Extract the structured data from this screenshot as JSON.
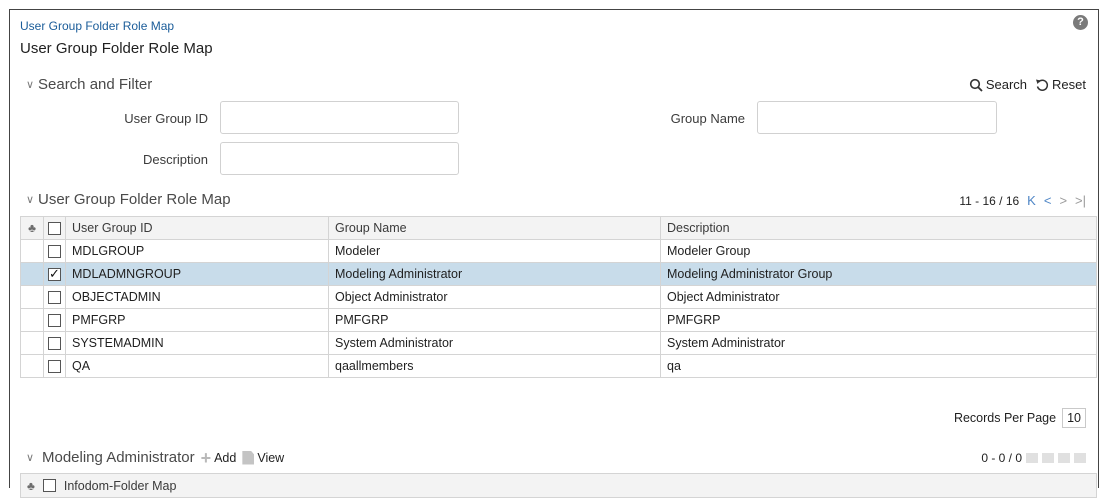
{
  "breadcrumb": "User Group Folder Role Map",
  "page_title": "User Group Folder Role Map",
  "help_icon": "?",
  "search_filter": {
    "title": "Search and Filter",
    "search_label": "Search",
    "reset_label": "Reset",
    "fields": {
      "user_group_id_label": "User Group ID",
      "user_group_id_value": "",
      "group_name_label": "Group Name",
      "group_name_value": "",
      "description_label": "Description",
      "description_value": ""
    }
  },
  "grid": {
    "title": "User Group Folder Role Map",
    "pagination": "11 - 16 / 16",
    "columns": [
      "User Group ID",
      "Group Name",
      "Description"
    ],
    "rows": [
      {
        "id": "MDLGROUP",
        "name": "Modeler",
        "description": "Modeler Group",
        "checked": false
      },
      {
        "id": "MDLADMNGROUP",
        "name": "Modeling Administrator",
        "description": "Modeling Administrator Group",
        "checked": true
      },
      {
        "id": "OBJECTADMIN",
        "name": "Object Administrator",
        "description": "Object Administrator",
        "checked": false
      },
      {
        "id": "PMFGRP",
        "name": "PMFGRP",
        "description": "PMFGRP",
        "checked": false
      },
      {
        "id": "SYSTEMADMIN",
        "name": "System Administrator",
        "description": "System Administrator",
        "checked": false
      },
      {
        "id": "QA",
        "name": "qaallmembers",
        "description": "qa",
        "checked": false
      }
    ],
    "records_per_page_label": "Records Per Page",
    "records_per_page": "10"
  },
  "detail": {
    "title": "Modeling Administrator",
    "add_label": "Add",
    "view_label": "View",
    "pagination": "0 - 0 / 0",
    "column": "Infodom-Folder Map"
  },
  "colors": {
    "selected_row": "#c8dcea",
    "link": "#1a5c99",
    "header_bg": "#f3f3f3"
  }
}
